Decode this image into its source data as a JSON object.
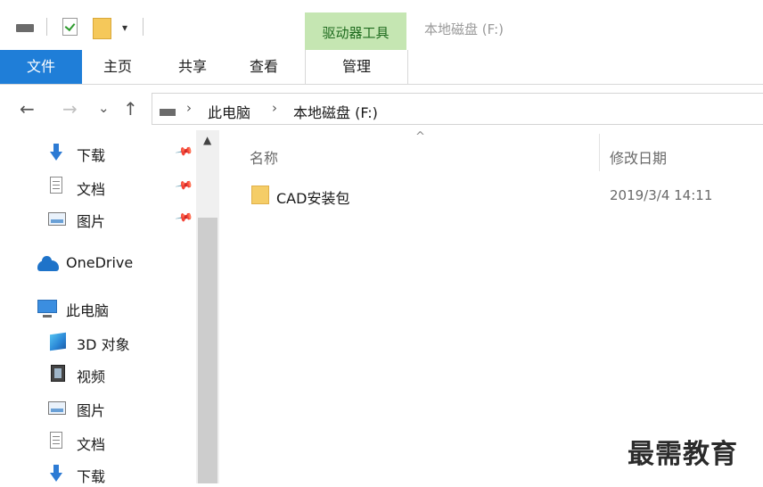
{
  "titlebar": {
    "contextual_tab": "驱动器工具",
    "window_title": "本地磁盘 (F:)",
    "quick_access_icons": [
      "drive-icon",
      "properties-check-icon",
      "new-folder-icon",
      "customize-dropdown-icon"
    ],
    "quick_access_dropdown": "▾"
  },
  "ribbon": {
    "tabs": [
      {
        "label": "文件"
      },
      {
        "label": "主页"
      },
      {
        "label": "共享"
      },
      {
        "label": "查看"
      },
      {
        "label": "管理"
      }
    ],
    "file_tab_color": "#1f7ed8",
    "contextual_color": "#c5e6b2"
  },
  "navigation": {
    "back": "←",
    "forward": "→",
    "recent": "⌄",
    "up": "↑"
  },
  "address": {
    "separator": "›",
    "parts": [
      "此电脑",
      "本地磁盘 (F:)"
    ]
  },
  "navpane": {
    "quick_access": [
      {
        "label": "下载",
        "icon": "download-arrow-icon",
        "pinned": true
      },
      {
        "label": "文档",
        "icon": "document-icon",
        "pinned": true
      },
      {
        "label": "图片",
        "icon": "pictures-icon",
        "pinned": true
      }
    ],
    "onedrive": {
      "label": "OneDrive",
      "icon": "onedrive-cloud-icon"
    },
    "this_pc": {
      "label": "此电脑",
      "icon": "computer-icon"
    },
    "pc_children": [
      {
        "label": "3D 对象",
        "icon": "3d-objects-icon"
      },
      {
        "label": "视频",
        "icon": "videos-icon"
      },
      {
        "label": "图片",
        "icon": "pictures-icon"
      },
      {
        "label": "文档",
        "icon": "document-icon"
      },
      {
        "label": "下载",
        "icon": "download-arrow-icon"
      }
    ],
    "pin_glyph": "📌",
    "scroll_up_glyph": "▲"
  },
  "content": {
    "columns": {
      "name": "名称",
      "modified": "修改日期"
    },
    "sort_indicator": "^",
    "files": [
      {
        "name": "CAD安装包",
        "modified": "2019/3/4 14:11",
        "type": "folder"
      }
    ]
  },
  "watermark": "最需教育"
}
